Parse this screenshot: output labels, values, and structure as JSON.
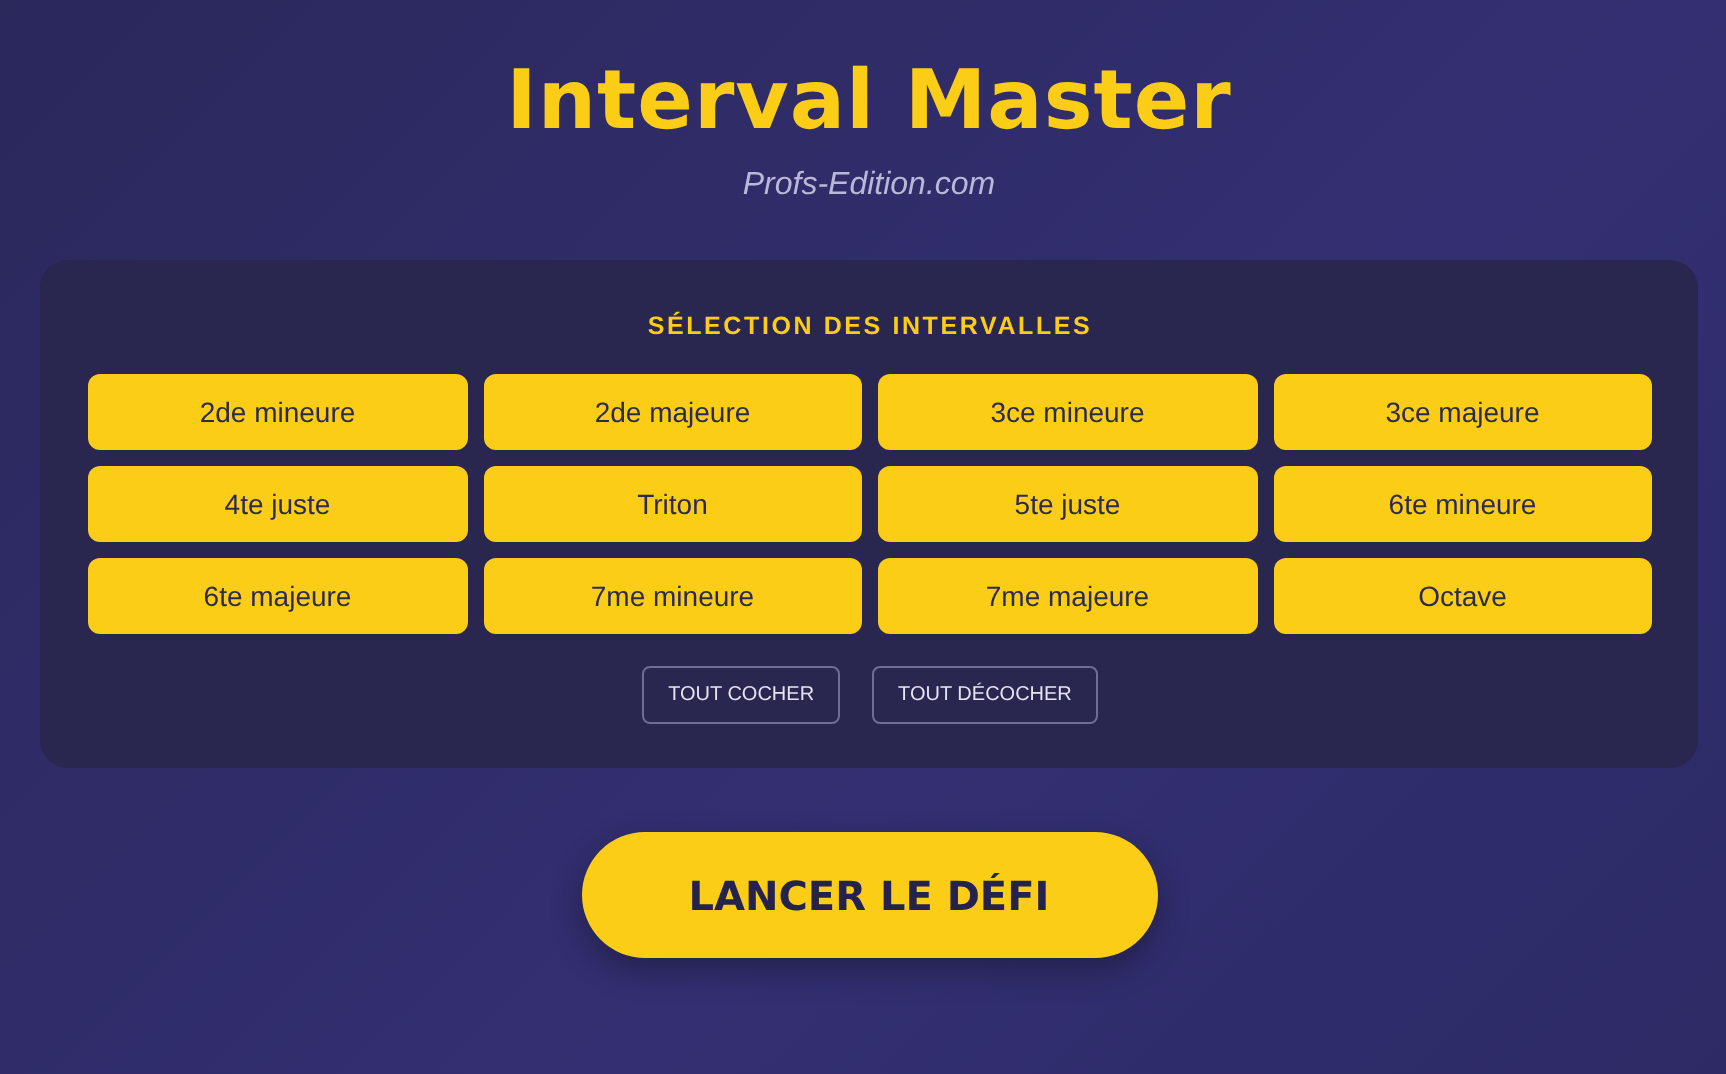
{
  "title": "Interval Master",
  "subtitle": "Profs-Edition.com",
  "panel": {
    "heading": "SÉLECTION DES INTERVALLES",
    "intervals": [
      {
        "label": "2de mineure",
        "selected": true
      },
      {
        "label": "2de majeure",
        "selected": true
      },
      {
        "label": "3ce mineure",
        "selected": true
      },
      {
        "label": "3ce majeure",
        "selected": true
      },
      {
        "label": "4te juste",
        "selected": true
      },
      {
        "label": "Triton",
        "selected": true
      },
      {
        "label": "5te juste",
        "selected": true
      },
      {
        "label": "6te mineure",
        "selected": true
      },
      {
        "label": "6te majeure",
        "selected": true
      },
      {
        "label": "7me mineure",
        "selected": true
      },
      {
        "label": "7me majeure",
        "selected": true
      },
      {
        "label": "Octave",
        "selected": true
      }
    ],
    "buttons": [
      "TOUT COCHER",
      "TOUT DÉCOCHER"
    ]
  },
  "start_button": "LANCER LE DÉFI"
}
